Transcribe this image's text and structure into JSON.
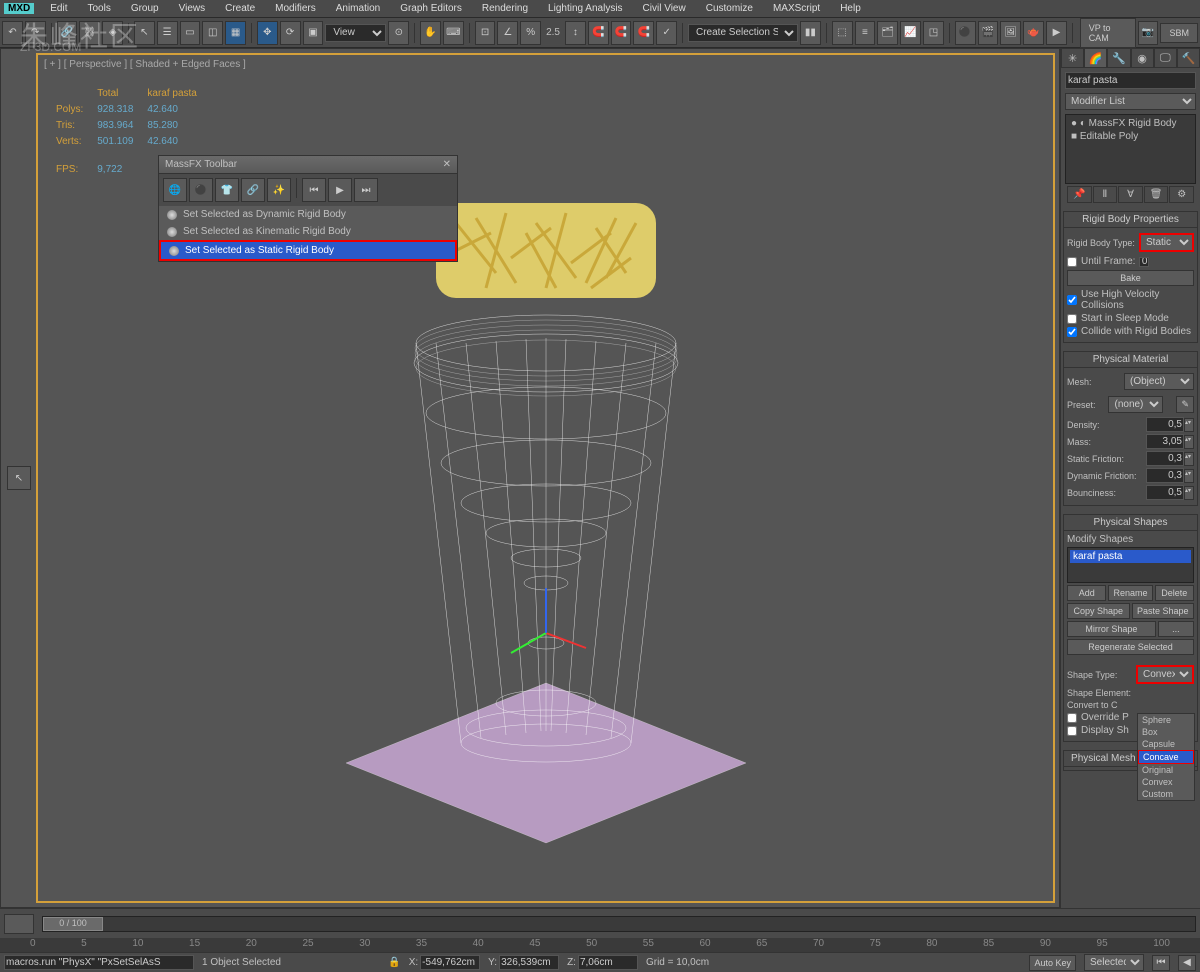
{
  "menu": {
    "mxd": "MXD",
    "items": [
      "Edit",
      "Tools",
      "Group",
      "Views",
      "Create",
      "Modifiers",
      "Animation",
      "Graph Editors",
      "Rendering",
      "Lighting Analysis",
      "Civil View",
      "Customize",
      "MAXScript",
      "Help"
    ]
  },
  "toolbar": {
    "dropdown": "View",
    "selset": "Create Selection Se",
    "right_btns": [
      "VP to CAM",
      "SBM"
    ],
    "snap_val": "2.5"
  },
  "viewport": {
    "label": "[ + ] [ Perspective ] [ Shaded + Edged Faces ]"
  },
  "stats": {
    "cols": [
      "Total",
      "karaf pasta"
    ],
    "rows": [
      {
        "lbl": "Polys:",
        "v1": "928.318",
        "v2": "42.640"
      },
      {
        "lbl": "Tris:",
        "v1": "983.964",
        "v2": "85.280"
      },
      {
        "lbl": "Verts:",
        "v1": "501.109",
        "v2": "42.640"
      }
    ],
    "fps_lbl": "FPS:",
    "fps": "9,722"
  },
  "massfx": {
    "title": "MassFX Toolbar",
    "items": [
      "Set Selected as Dynamic Rigid Body",
      "Set Selected as Kinematic Rigid Body",
      "Set Selected as Static Rigid Body"
    ]
  },
  "rpanel": {
    "objname": "karaf pasta",
    "modlist": "Modifier List",
    "stack": [
      "MassFX Rigid Body",
      "Editable Poly"
    ],
    "rb_section": "Rigid Body Properties",
    "rb_type_lbl": "Rigid Body Type:",
    "rb_type": "Static",
    "until_lbl": "Until Frame:",
    "until_val": "0",
    "bake": "Bake",
    "hivel": "Use High Velocity Collisions",
    "sleep": "Start in Sleep Mode",
    "collide": "Collide with Rigid Bodies",
    "pm_section": "Physical Material",
    "mesh_lbl": "Mesh:",
    "mesh": "(Object)",
    "preset_lbl": "Preset:",
    "preset": "(none)",
    "density_lbl": "Density:",
    "density": "0,5",
    "mass_lbl": "Mass:",
    "mass": "3,05",
    "sfric_lbl": "Static Friction:",
    "sfric": "0,3",
    "dfric_lbl": "Dynamic Friction:",
    "dfric": "0,3",
    "bounce_lbl": "Bounciness:",
    "bounce": "0,5",
    "ps_section": "Physical Shapes",
    "modshapes": "Modify Shapes",
    "shape_item": "karaf pasta",
    "btns": {
      "add": "Add",
      "rename": "Rename",
      "delete": "Delete",
      "copy": "Copy Shape",
      "paste": "Paste Shape",
      "mirror": "Mirror Shape",
      "dots": "...",
      "regen": "Regenerate Selected"
    },
    "shapetype_lbl": "Shape Type:",
    "shapetype": "Convex",
    "shapeel_lbl": "Shape Element:",
    "convert_lbl": "Convert to C",
    "override": "Override P",
    "display": "Display Sh",
    "shape_opts": [
      "Sphere",
      "Box",
      "Capsule",
      "Concave",
      "Original",
      "Convex",
      "Custom"
    ],
    "pmesh": "Physical Mesh Parameters"
  },
  "timeline": {
    "pos": "0 / 100",
    "ticks": [
      "0",
      "5",
      "10",
      "15",
      "20",
      "25",
      "30",
      "35",
      "40",
      "45",
      "50",
      "55",
      "60",
      "65",
      "70",
      "75",
      "80",
      "85",
      "90",
      "95",
      "100"
    ]
  },
  "status": {
    "script": "macros.run \"PhysX\" \"PxSetSelAsS",
    "sel": "1 Object Selected",
    "x": "-549,762cm",
    "y": "326,539cm",
    "z": "7,06cm",
    "grid": "Grid = 10,0cm",
    "autokey": "Auto Key",
    "selected": "Selected"
  },
  "watermark": "朱峰社区",
  "watermark2": "ZF3D.COM"
}
